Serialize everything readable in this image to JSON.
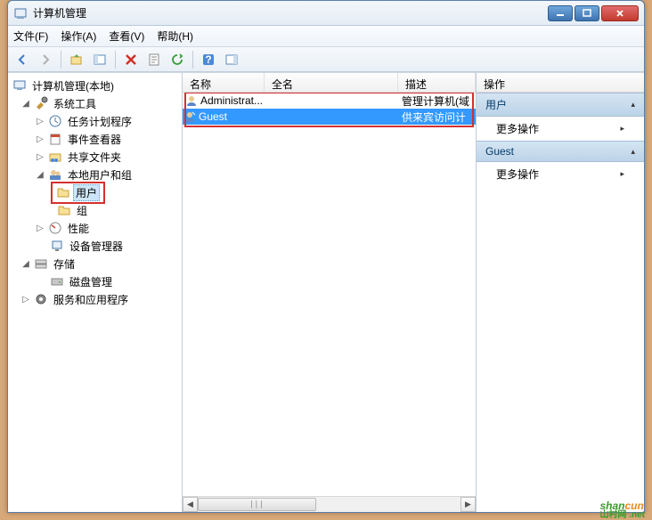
{
  "window": {
    "title": "计算机管理"
  },
  "menu": {
    "file": "文件(F)",
    "action": "操作(A)",
    "view": "查看(V)",
    "help": "帮助(H)"
  },
  "tree": {
    "root": "计算机管理(本地)",
    "systools": "系统工具",
    "tasksched": "任务计划程序",
    "eventview": "事件查看器",
    "shared": "共享文件夹",
    "localusers": "本地用户和组",
    "users": "用户",
    "groups": "组",
    "perf": "性能",
    "devmgr": "设备管理器",
    "storage": "存储",
    "diskmgmt": "磁盘管理",
    "services": "服务和应用程序"
  },
  "list": {
    "columns": {
      "name": "名称",
      "fullname": "全名",
      "desc": "描述"
    },
    "rows": [
      {
        "name": "Administrat...",
        "fullname": "",
        "desc": "管理计算机(域"
      },
      {
        "name": "Guest",
        "fullname": "",
        "desc": "供来宾访问计"
      }
    ]
  },
  "actions": {
    "header": "操作",
    "group1": "用户",
    "group2": "Guest",
    "more": "更多操作"
  },
  "watermark": {
    "text1": "shan",
    "text2": "cun",
    "sub": "山村网 .net"
  }
}
